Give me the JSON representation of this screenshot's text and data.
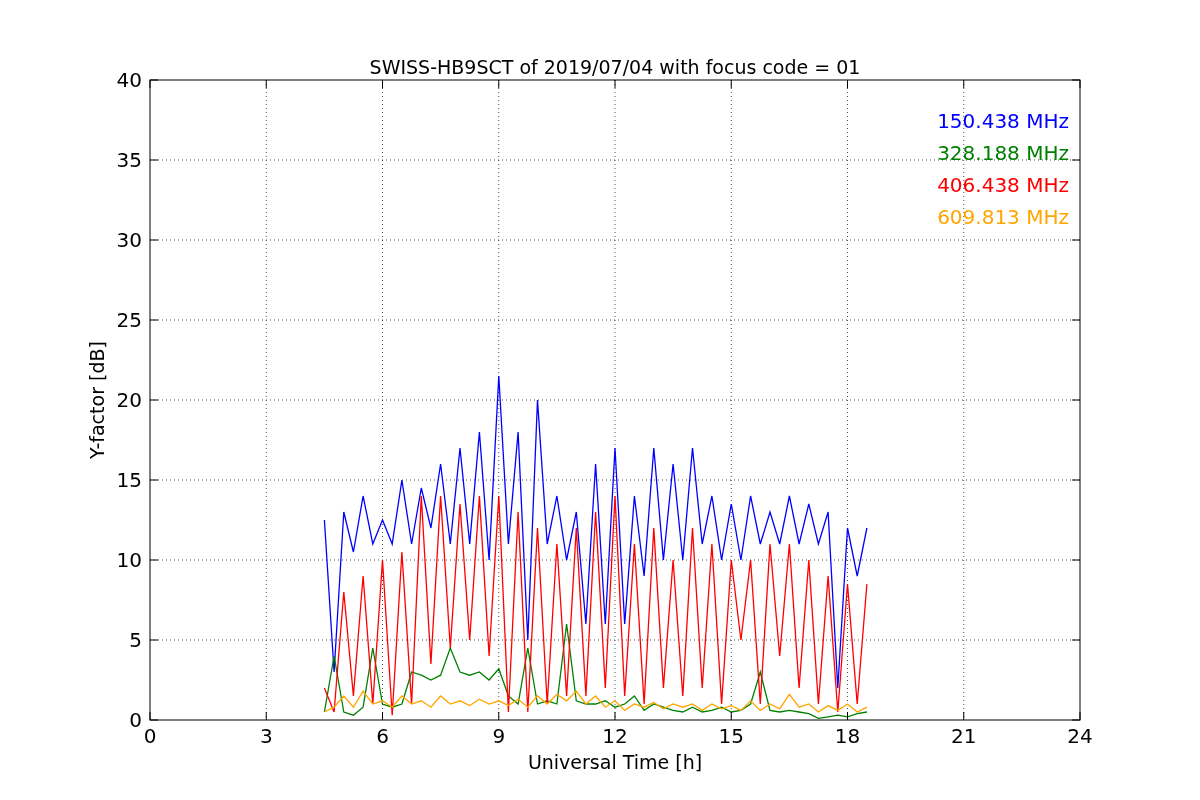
{
  "chart": {
    "chart_data": {
      "type": "line",
      "title": "SWISS-HB9SCT of 2019/07/04 with focus code = 01",
      "xlabel": "Universal Time [h]",
      "ylabel": "Y-factor [dB]",
      "x": [
        4.5,
        4.75,
        5,
        5.25,
        5.5,
        5.75,
        6,
        6.25,
        6.5,
        6.75,
        7,
        7.25,
        7.5,
        7.75,
        8,
        8.25,
        8.5,
        8.75,
        9,
        9.25,
        9.5,
        9.75,
        10,
        10.25,
        10.5,
        10.75,
        11,
        11.25,
        11.5,
        11.75,
        12,
        12.25,
        12.5,
        12.75,
        13,
        13.25,
        13.5,
        13.75,
        14,
        14.25,
        14.5,
        14.75,
        15,
        15.25,
        15.5,
        15.75,
        16,
        16.25,
        16.5,
        16.75,
        17,
        17.25,
        17.5,
        17.75,
        18,
        18.25,
        18.5
      ],
      "series": [
        {
          "name": "150.438 MHz",
          "color": "#0000ff",
          "values": [
            12.5,
            3,
            13,
            10.5,
            14,
            11,
            12.5,
            11,
            15,
            11,
            14.5,
            12,
            16,
            11,
            17,
            11,
            18,
            10,
            21.5,
            11,
            18,
            5,
            20,
            11,
            14,
            10,
            13,
            6,
            16,
            6,
            17,
            6,
            14,
            9,
            17,
            10,
            16,
            10,
            17,
            11,
            14,
            10,
            13.5,
            10,
            14,
            11,
            13,
            11,
            14,
            11,
            13.5,
            11,
            13,
            2,
            12,
            9,
            12
          ]
        },
        {
          "name": "328.188 MHz",
          "color": "#008000",
          "values": [
            0.5,
            4,
            0.5,
            0.3,
            0.8,
            4.5,
            1,
            0.8,
            1,
            3,
            2.8,
            2.5,
            2.8,
            4.5,
            3,
            2.8,
            3,
            2.5,
            3.2,
            1.5,
            1,
            4.5,
            1,
            1.2,
            1,
            6,
            1.2,
            1,
            1,
            1.2,
            0.8,
            1,
            1.5,
            0.6,
            1,
            0.8,
            0.6,
            0.5,
            0.8,
            0.5,
            0.6,
            0.8,
            0.5,
            0.6,
            1,
            3,
            0.6,
            0.5,
            0.6,
            0.5,
            0.4,
            0.1,
            0.2,
            0.3,
            0.2,
            0.4,
            0.5
          ]
        },
        {
          "name": "406.438 MHz",
          "color": "#ff0000",
          "values": [
            2,
            0.5,
            8,
            1.5,
            9,
            1,
            10,
            0.3,
            10.5,
            1,
            14,
            3.5,
            14,
            4.5,
            13.5,
            5,
            14,
            4,
            14,
            0.5,
            13,
            0.5,
            12,
            1,
            11,
            1.5,
            12,
            1.5,
            13,
            2,
            14,
            1.5,
            11,
            1,
            12,
            2,
            10,
            1.5,
            12,
            2,
            11,
            1,
            10,
            5,
            10,
            1,
            11,
            4,
            11,
            2,
            10,
            1,
            9,
            0.5,
            8.5,
            1,
            8.5
          ]
        },
        {
          "name": "609.813 MHz",
          "color": "#ffa500",
          "values": [
            0.5,
            0.8,
            1.5,
            0.8,
            1.8,
            1,
            1.2,
            0.8,
            1.5,
            1,
            1.2,
            0.8,
            1.5,
            1,
            1.2,
            0.9,
            1.3,
            1,
            1.2,
            0.9,
            1.3,
            0.8,
            1.5,
            1,
            1.6,
            1.2,
            1.8,
            1,
            1.5,
            0.8,
            1.2,
            0.6,
            1,
            0.8,
            1.1,
            0.7,
            1,
            0.8,
            1,
            0.6,
            1,
            0.7,
            0.9,
            0.6,
            1.2,
            0.6,
            1,
            0.7,
            1.6,
            0.8,
            1,
            0.5,
            0.9,
            0.6,
            1,
            0.5,
            0.8
          ]
        }
      ],
      "xlim": [
        0,
        24
      ],
      "ylim": [
        0,
        40
      ],
      "xticks": [
        0,
        3,
        6,
        9,
        12,
        15,
        18,
        21,
        24
      ],
      "yticks": [
        0,
        5,
        10,
        15,
        20,
        25,
        30,
        35,
        40
      ],
      "grid": true
    }
  }
}
